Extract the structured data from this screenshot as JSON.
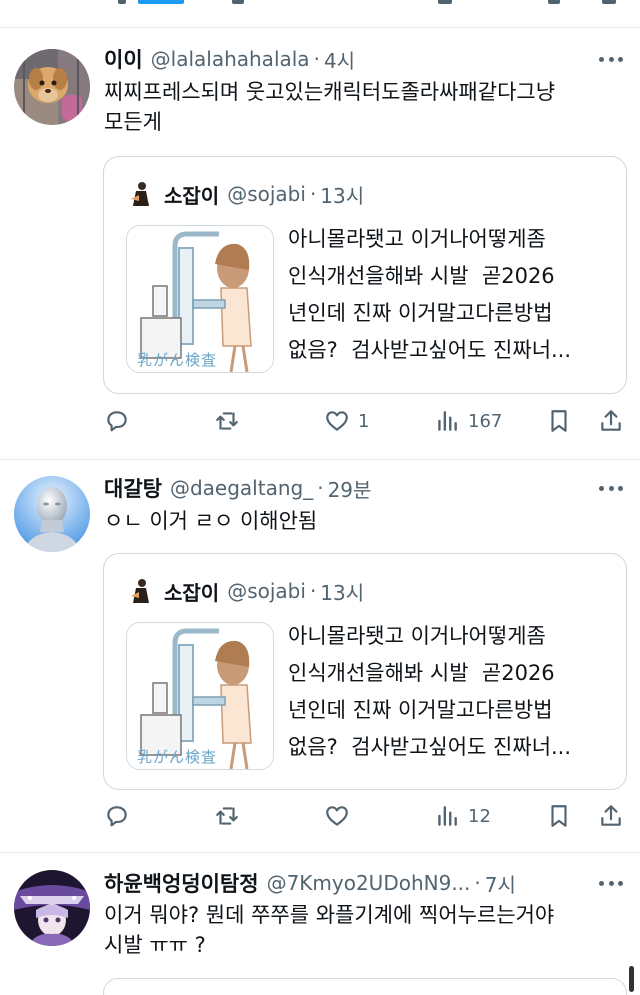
{
  "colors": {
    "accent": "#1d9bf0",
    "secondary_text": "#536471",
    "primary_text": "#0f1419",
    "border": "#cfd9de"
  },
  "tweets": [
    {
      "name": "이이",
      "handle": "@lalalahahalala",
      "separator": "·",
      "time": "4시",
      "text": "찌찌프레스되며 웃고있는캐릭터도졸라싸패같다그냥\n모든게",
      "avatar_icon": "dog-photo-avatar",
      "quote": {
        "name": "소잡이",
        "handle": "@sojabi",
        "separator": "·",
        "time": "13시",
        "text": "아니몰라됏고 이거나어떻게좀\n인식개선을해봐 시발  곧2026\n년인데 진짜 이거말고다른방법\n없음?  검사받고싶어도 진짜너...",
        "thumbnail_caption": "乳がん検査"
      },
      "actions": {
        "reply": "",
        "repost": "",
        "like": "1",
        "views": "167"
      }
    },
    {
      "name": "대갈탕",
      "handle": "@daegaltang_",
      "separator": "·",
      "time": "29분",
      "text": "ㅇㄴ 이거 ㄹㅇ 이해안됨",
      "avatar_icon": "mannequin-head-avatar",
      "quote": {
        "name": "소잡이",
        "handle": "@sojabi",
        "separator": "·",
        "time": "13시",
        "text": "아니몰라됏고 이거나어떻게좀\n인식개선을해봐 시발  곧2026\n년인데 진짜 이거말고다른방법\n없음?  검사받고싶어도 진짜너...",
        "thumbnail_caption": "乳がん検査"
      },
      "actions": {
        "reply": "",
        "repost": "",
        "like": "",
        "views": "12"
      }
    },
    {
      "name": "하윤백엉덩이탐정",
      "handle": "@7Kmyo2UDohN9...",
      "separator": "·",
      "time": "7시",
      "text": "이거 뭐야? 뭔데 쭈쭈를 와플기계에 찍어누르는거야\n시발 ㅠㅠ ?",
      "avatar_icon": "anime-character-avatar"
    }
  ]
}
